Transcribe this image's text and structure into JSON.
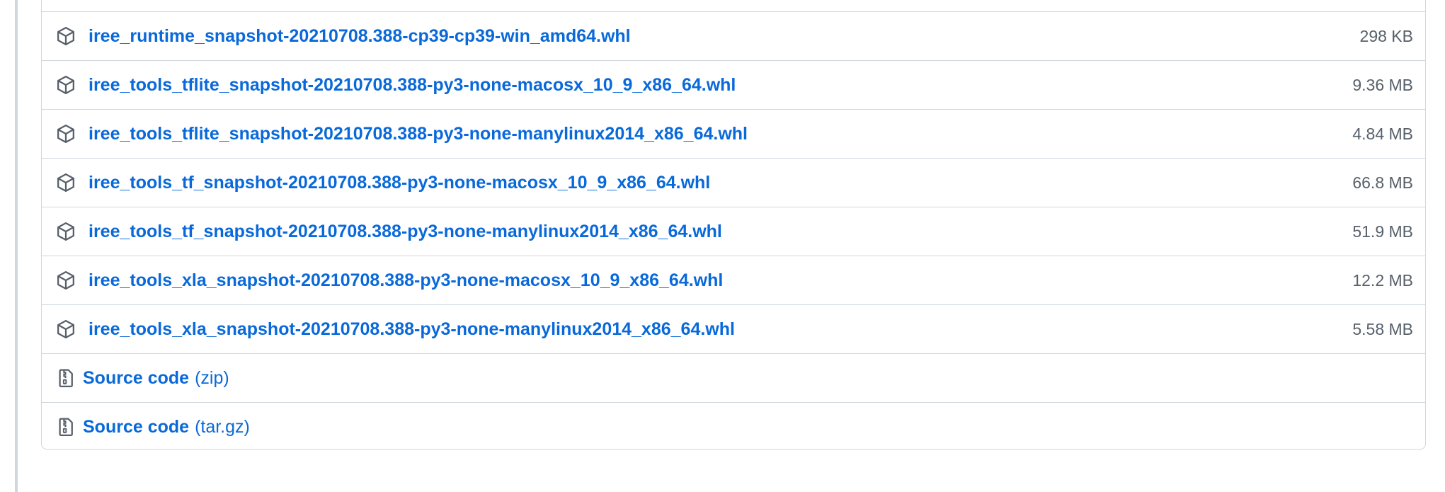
{
  "assets": [
    {
      "name": "iree_runtime_snapshot-20210708.388-cp39-cp39-win_amd64.whl",
      "size": "298 KB",
      "icon": "package-icon"
    },
    {
      "name": "iree_tools_tflite_snapshot-20210708.388-py3-none-macosx_10_9_x86_64.whl",
      "size": "9.36 MB",
      "icon": "package-icon"
    },
    {
      "name": "iree_tools_tflite_snapshot-20210708.388-py3-none-manylinux2014_x86_64.whl",
      "size": "4.84 MB",
      "icon": "package-icon"
    },
    {
      "name": "iree_tools_tf_snapshot-20210708.388-py3-none-macosx_10_9_x86_64.whl",
      "size": "66.8 MB",
      "icon": "package-icon"
    },
    {
      "name": "iree_tools_tf_snapshot-20210708.388-py3-none-manylinux2014_x86_64.whl",
      "size": "51.9 MB",
      "icon": "package-icon"
    },
    {
      "name": "iree_tools_xla_snapshot-20210708.388-py3-none-macosx_10_9_x86_64.whl",
      "size": "12.2 MB",
      "icon": "package-icon"
    },
    {
      "name": "iree_tools_xla_snapshot-20210708.388-py3-none-manylinux2014_x86_64.whl",
      "size": "5.58 MB",
      "icon": "package-icon"
    }
  ],
  "source_code": [
    {
      "label": "Source code",
      "suffix": "(zip)",
      "icon": "file-zip-icon"
    },
    {
      "label": "Source code",
      "suffix": "(tar.gz)",
      "icon": "file-zip-icon"
    }
  ],
  "colors": {
    "link": "#0969da",
    "muted": "#57606a",
    "border": "#d0d7de"
  }
}
